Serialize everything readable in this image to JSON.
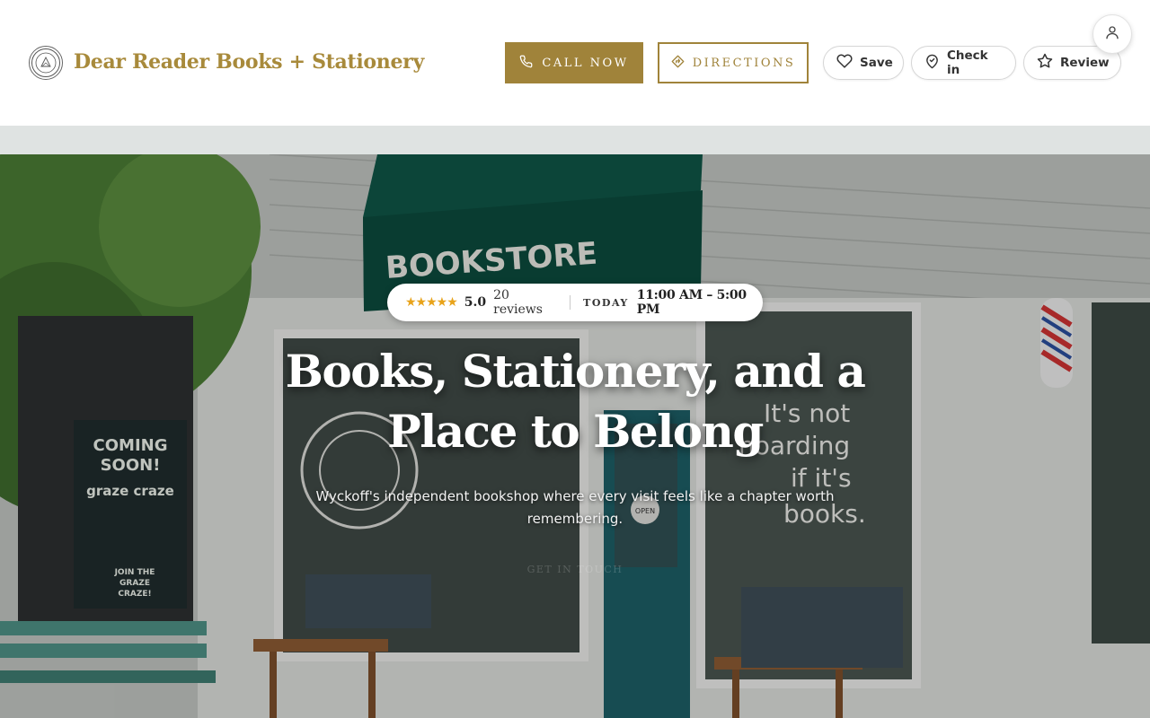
{
  "header": {
    "brand_name": "Dear Reader Books + Stationery",
    "call_label": "CALL NOW",
    "directions_label": "DIRECTIONS",
    "save_label": "Save",
    "checkin_label": "Check in",
    "review_label": "Review"
  },
  "hero": {
    "stars": "★★★★★",
    "rating": "5.0",
    "reviews": "20 reviews",
    "today_label": "TODAY",
    "hours": "11:00 AM – 5:00 PM",
    "title": "Books, Stationery, and a Place to Belong",
    "subtitle": "Wyckoff's independent bookshop where every visit feels like a chapter worth remembering.",
    "cta": "GET IN TOUCH"
  },
  "photo": {
    "awning_text": "BOOKSTORE",
    "window_text_lines": [
      "It's not",
      "hoarding",
      "if it's",
      "books."
    ],
    "poster_lines": [
      "COMING",
      "SOON!",
      "graze craze",
      "JOIN THE",
      "GRAZE",
      "CRAZE!"
    ],
    "door_sign": "OPEN"
  },
  "colors": {
    "brand_gold": "#a0833a",
    "star_color": "#e8a31b",
    "awning_green": "#0f5546",
    "door_teal": "#1d5d64"
  },
  "icons": {
    "logo": "dear-reader-seal-icon",
    "call": "phone-icon",
    "directions": "directions-diamond-icon",
    "save": "heart-icon",
    "checkin": "map-pin-check-icon",
    "review": "star-outline-icon",
    "account": "user-icon"
  }
}
